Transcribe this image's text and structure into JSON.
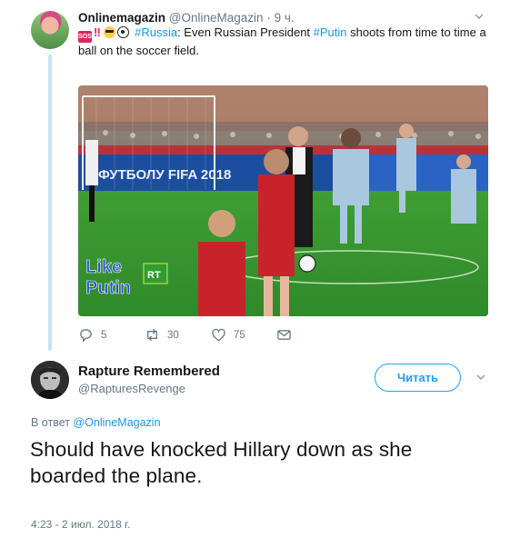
{
  "tweet": {
    "author_name": "Onlinemagazin",
    "author_handle": "@OnlineMagazin",
    "separator": "·",
    "time": "9 ч.",
    "emoji_names": [
      "sos-icon",
      "double-exclamation-icon",
      "sunglasses-face-icon",
      "soccer-ball-icon"
    ],
    "bang": "‼",
    "hashtag_russia": "#Russia",
    "text_part1": ": Even Russian President ",
    "hashtag_putin": "#Putin",
    "text_part2": " shoots from time to time a ball on the soccer field.",
    "media": {
      "banner_text": "ФУТБОЛУ FIFA 2018",
      "overlay_line1": "Like",
      "overlay_line2": "Putin",
      "channel_logo": "RT"
    },
    "actions": {
      "reply_count": "5",
      "retweet_count": "30",
      "like_count": "75"
    }
  },
  "reply": {
    "author_name": "Rapture Remembered",
    "author_handle": "@RapturesRevenge",
    "follow_label": "Читать",
    "replying_prefix": "В ответ",
    "replying_to": "@OnlineMagazin",
    "text": "Should have knocked Hillary down as she boarded the plane.",
    "timestamp": "4:23 - 2 июл. 2018 г."
  },
  "colors": {
    "link": "#1b95e0",
    "follow": "#1da1f2",
    "muted": "#657786",
    "thread_line": "#c4e4f5"
  }
}
